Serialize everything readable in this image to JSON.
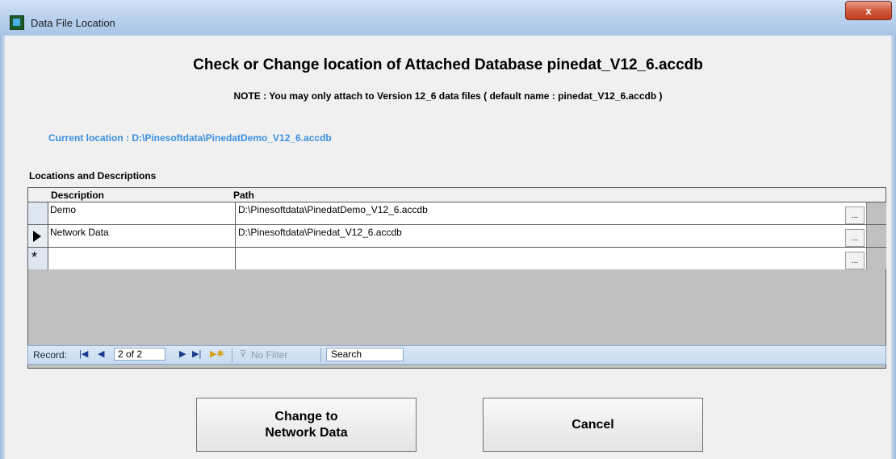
{
  "window": {
    "title": "Data File Location",
    "close_label": "x"
  },
  "heading": "Check or Change location of Attached Database pinedat_V12_6.accdb",
  "note": "NOTE :  You may only attach to Version 12_6 data files   ( default name  :  pinedat_V12_6.accdb )",
  "current_location": "Current location : D:\\Pinesoftdata\\PinedatDemo_V12_6.accdb",
  "locations_label": "Locations and Descriptions",
  "grid": {
    "columns": [
      "Description",
      "Path"
    ],
    "rows": [
      {
        "description": "Demo",
        "path": "D:\\Pinesoftdata\\PinedatDemo_V12_6.accdb",
        "browse": "..."
      },
      {
        "description": "Network Data",
        "path": "D:\\Pinesoftdata\\Pinedat_V12_6.accdb",
        "browse": "..."
      },
      {
        "description": "",
        "path": "",
        "browse": "..."
      }
    ],
    "new_record_marker": "*"
  },
  "navigator": {
    "record_label": "Record:",
    "record_value": "2 of 2",
    "filter_label": "No Filter",
    "search_label": "Search",
    "icons": [
      "first-record-icon",
      "prev-record-icon",
      "next-record-icon",
      "last-record-icon",
      "new-record-icon",
      "filter-icon"
    ]
  },
  "buttons": {
    "change_line1": "Change to",
    "change_line2": "Network Data",
    "cancel": "Cancel"
  }
}
